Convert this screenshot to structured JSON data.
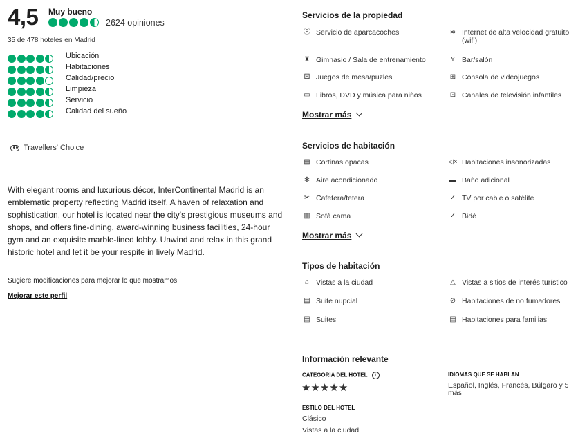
{
  "overview": {
    "rating": "4,5",
    "rating_word": "Muy bueno",
    "rating_bubbles": 4.5,
    "review_count": "2624 opiniones",
    "rank": "35 de 478 hoteles en Madrid",
    "subratings": [
      {
        "label": "Ubicación",
        "value": 4.5
      },
      {
        "label": "Habitaciones",
        "value": 4.5
      },
      {
        "label": "Calidad/precio",
        "value": 4.0
      },
      {
        "label": "Limpieza",
        "value": 4.5
      },
      {
        "label": "Servicio",
        "value": 4.5
      },
      {
        "label": "Calidad del sueño",
        "value": 4.5
      }
    ],
    "award": "Travellers' Choice",
    "description": "With elegant rooms and luxurious décor, InterContinental Madrid is an emblematic property reflecting Madrid itself. A haven of relaxation and sophistication, our hotel is located near the city's prestigious museums and shops, and offers fine-dining, award-winning business facilities, 24-hour gym and an exquisite marble-lined lobby. Unwind and relax in this grand historic hotel and let it be your respite in lively Madrid.",
    "suggest_text": "Sugiere modificaciones para mejorar lo que mostramos.",
    "improve_link": "Mejorar este perfil"
  },
  "property_amenities": {
    "title": "Servicios de la propiedad",
    "items": [
      {
        "label": "Servicio de aparcacoches",
        "icon": "parking-icon"
      },
      {
        "label": "Internet de alta velocidad gratuito (wifi)",
        "icon": "wifi-icon"
      },
      {
        "label": "Gimnasio / Sala de entrenamiento",
        "icon": "gym-icon"
      },
      {
        "label": "Bar/salón",
        "icon": "cocktail-icon"
      },
      {
        "label": "Juegos de mesa/puzles",
        "icon": "dice-icon"
      },
      {
        "label": "Consola de videojuegos",
        "icon": "gamepad-icon"
      },
      {
        "label": "Libros, DVD y música para niños",
        "icon": "book-icon"
      },
      {
        "label": "Canales de televisión infantiles",
        "icon": "tv-icon"
      }
    ],
    "show_more": "Mostrar más"
  },
  "room_features": {
    "title": "Servicios de habitación",
    "items": [
      {
        "label": "Cortinas opacas",
        "icon": "blinds-icon"
      },
      {
        "label": "Habitaciones insonorizadas",
        "icon": "soundproof-icon"
      },
      {
        "label": "Aire acondicionado",
        "icon": "snowflake-icon"
      },
      {
        "label": "Baño adicional",
        "icon": "bathtub-icon"
      },
      {
        "label": "Cafetera/tetera",
        "icon": "coffee-icon"
      },
      {
        "label": "TV por cable o satélite",
        "icon": "check-icon"
      },
      {
        "label": "Sofá cama",
        "icon": "sofa-bed-icon"
      },
      {
        "label": "Bidé",
        "icon": "check-icon"
      }
    ],
    "show_more": "Mostrar más"
  },
  "room_types": {
    "title": "Tipos de habitación",
    "items": [
      {
        "label": "Vistas a la ciudad",
        "icon": "city-icon"
      },
      {
        "label": "Vistas a sitios de interés turístico",
        "icon": "landmark-icon"
      },
      {
        "label": "Suite nupcial",
        "icon": "bed-icon"
      },
      {
        "label": "Habitaciones de no fumadores",
        "icon": "no-smoking-icon"
      },
      {
        "label": "Suites",
        "icon": "bed-icon"
      },
      {
        "label": "Habitaciones para familias",
        "icon": "bed-icon"
      }
    ]
  },
  "relevant_info": {
    "title": "Información relevante",
    "category_label": "CATEGORÍA DEL HOTEL",
    "category_stars": 5,
    "languages_label": "IDIOMAS QUE SE HABLAN",
    "languages_value": "Español, Inglés, Francés, Búlgaro y 5 más",
    "style_label": "ESTILO DEL HOTEL",
    "style_values": [
      "Clásico",
      "Vistas a la ciudad"
    ]
  }
}
